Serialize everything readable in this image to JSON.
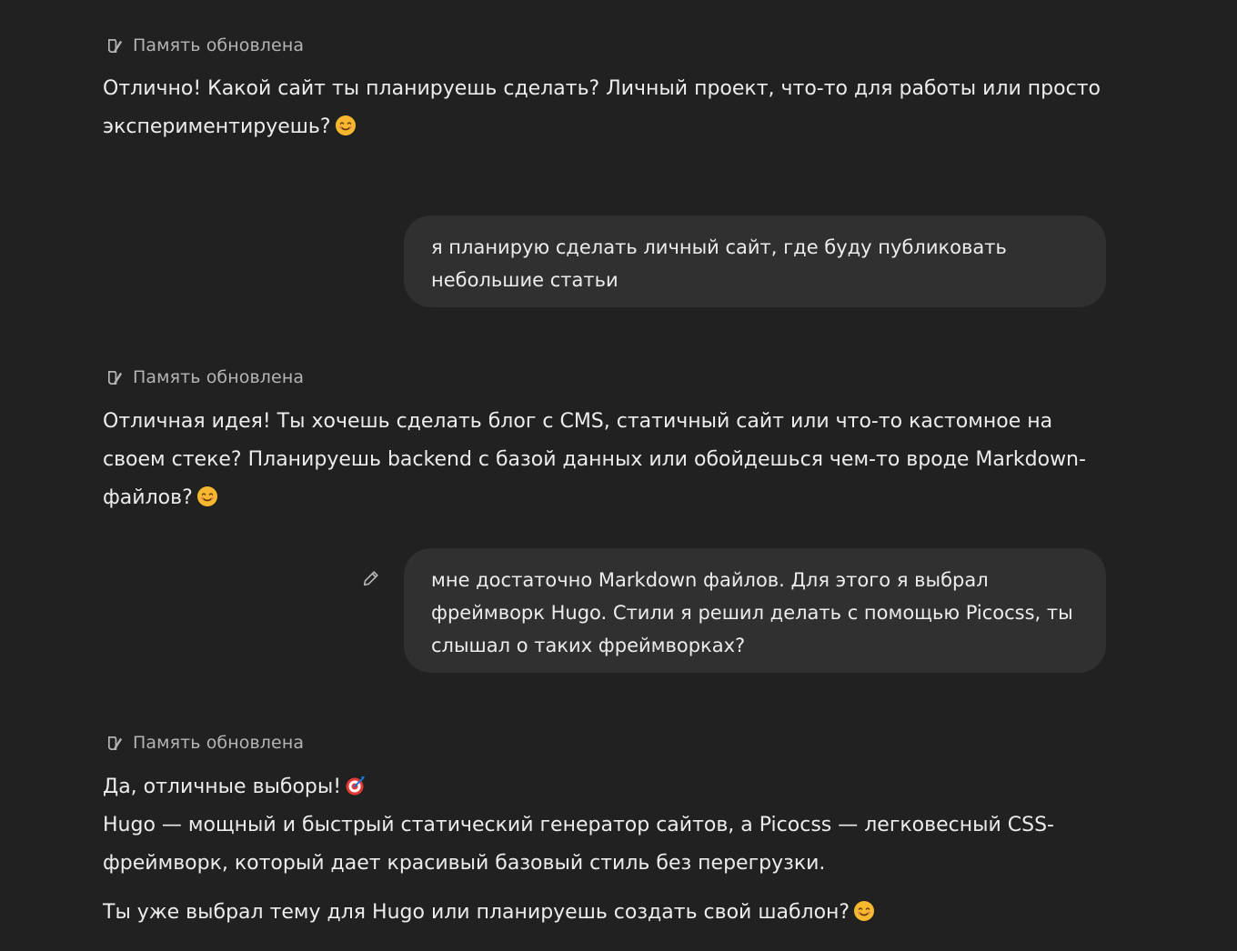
{
  "messages": {
    "memory_label": "Память обновлена",
    "m1": {
      "text": "Отлично! Какой сайт ты планируешь сделать? Личный проект, что-то для работы или просто экспериментируешь?",
      "emoji": "smiling-face-icon"
    },
    "u1": {
      "text": "я планирую сделать личный сайт, где буду публиковать небольшие статьи"
    },
    "m2": {
      "text": "Отличная идея! Ты хочешь сделать блог с CMS, статичный сайт или что-то кастомное на своем стеке? Планируешь backend с базой данных или обойдешься чем-то вроде Markdown-файлов?",
      "emoji": "smiling-face-icon"
    },
    "u2": {
      "text": "мне достаточно Markdown файлов. Для этого я выбрал фреймворк Hugo. Стили я решил делать с помощью Picocss, ты слышал о таких фреймворках?",
      "edit_icon": "pencil-icon"
    },
    "m3": {
      "line1": "Да, отличные выборы!",
      "line1_emoji": "target-icon",
      "line2": "Hugo — мощный и быстрый статический генератор сайтов, а Picocss — легковесный CSS-фреймворк, который дает красивый базовый стиль без перегрузки.",
      "line3": "Ты уже выбрал тему для Hugo или планируешь создать свой шаблон?",
      "line3_emoji": "smiling-face-icon"
    }
  },
  "colors": {
    "background": "#212121",
    "bubble": "#303030",
    "text": "#ececec",
    "muted": "#b4b4b4",
    "emoji_yellow": "#f5b82e"
  }
}
